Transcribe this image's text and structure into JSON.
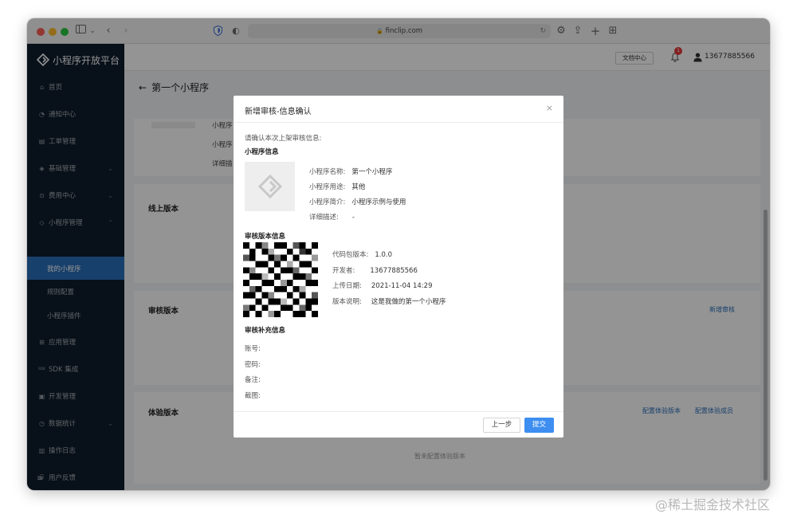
{
  "browser": {
    "url": "finclip.com",
    "lock_glyph": "🔒",
    "reload_glyph": "↻"
  },
  "sidebar": {
    "brand": "小程序开放平台",
    "items": [
      {
        "label": "首页",
        "icon": "home-icon",
        "glyph": "⌂"
      },
      {
        "label": "通知中心",
        "icon": "bell-icon",
        "glyph": "◔"
      },
      {
        "label": "工单管理",
        "icon": "ticket-icon",
        "glyph": "▤"
      },
      {
        "label": "基础管理",
        "icon": "layers-icon",
        "glyph": "◈",
        "chevron": "⌄"
      },
      {
        "label": "费用中心",
        "icon": "coin-icon",
        "glyph": "⊙",
        "chevron": "⌄"
      },
      {
        "label": "小程序管理",
        "icon": "miniapp-icon",
        "glyph": "◇",
        "chevron": "⌃"
      },
      {
        "label": "我的小程序",
        "active": true
      },
      {
        "label": "规则配置"
      },
      {
        "label": "小程序插件"
      },
      {
        "label": "应用管理",
        "icon": "grid-icon",
        "glyph": "⊞"
      },
      {
        "label": "SDK 集成",
        "icon": "sdk-icon",
        "glyph": "SDK"
      },
      {
        "label": "开发管理",
        "icon": "code-icon",
        "glyph": "▣"
      },
      {
        "label": "数据统计",
        "icon": "chart-icon",
        "glyph": "◷",
        "chevron": "⌄"
      },
      {
        "label": "操作日志",
        "icon": "log-icon",
        "glyph": "▥"
      },
      {
        "label": "用户反馈",
        "icon": "feedback-icon",
        "glyph": "⌸"
      }
    ],
    "collapse_glyph": "≡"
  },
  "topbar": {
    "doc_button": "文档中心",
    "notification_count": "1",
    "user_phone": "13677885566"
  },
  "page": {
    "back_glyph": "←",
    "title": "第一个小程序",
    "bg_labels": [
      "小程序",
      "小程序",
      "详细描"
    ],
    "online_version_title": "线上版本",
    "review_version_title": "审核版本",
    "new_review_link": "新增审核",
    "trial_version_title": "体验版本",
    "config_trial_version_link": "配置体验版本",
    "config_trial_members_link": "配置体验成员",
    "trial_empty_text": "暂未配置体验版本"
  },
  "modal": {
    "title": "新增审核-信息确认",
    "close_glyph": "×",
    "intro": "请确认本次上架审核信息:",
    "app_info_heading": "小程序信息",
    "app_info": [
      {
        "label": "小程序名称:",
        "value": "第一个小程序"
      },
      {
        "label": "小程序用途:",
        "value": "其他"
      },
      {
        "label": "小程序简介:",
        "value": "小程序示例与使用"
      },
      {
        "label": "详细描述:",
        "value": "-"
      }
    ],
    "version_heading": "审核版本信息",
    "version_info": [
      {
        "label": "代码包版本:",
        "value": "1.0.0"
      },
      {
        "label": "开发者:",
        "value": "13677885566"
      },
      {
        "label": "上传日期:",
        "value": "2021-11-04 14:29"
      },
      {
        "label": "版本说明:",
        "value": "这是我做的第一个小程序"
      }
    ],
    "supplement_heading": "审核补充信息",
    "supplement": [
      {
        "label": "账号:"
      },
      {
        "label": "密码:"
      },
      {
        "label": "备注:"
      },
      {
        "label": "截图:"
      }
    ],
    "prev_button": "上一步",
    "submit_button": "提交"
  },
  "watermark": "@稀土掘金技术社区",
  "colors": {
    "sidebar_bg": "#0e1c2b",
    "active_item": "#2a6fba",
    "primary_button": "#3d8ef0",
    "link": "#2a6fba",
    "badge": "#e5383b"
  }
}
